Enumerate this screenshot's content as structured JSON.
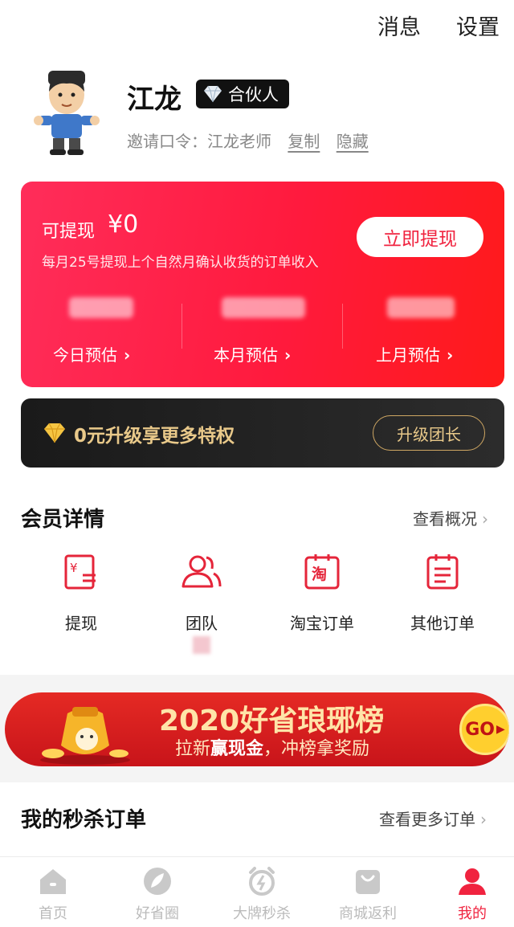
{
  "header": {
    "messages_label": "消息",
    "settings_label": "设置"
  },
  "profile": {
    "name": "江龙",
    "badge": "合伙人",
    "invite_label": "邀请口令：",
    "invite_code": "江龙老师",
    "copy_label": "复制",
    "hide_label": "隐藏"
  },
  "earnings": {
    "withdrawable_label": "可提现",
    "withdrawable_amount": "¥0",
    "note": "每月25号提现上个自然月确认收货的订单收入",
    "withdraw_button": "立即提现",
    "stats": [
      {
        "label": "今日预估"
      },
      {
        "label": "本月预估"
      },
      {
        "label": "上月预估"
      }
    ]
  },
  "upgrade": {
    "text": "0元升级享更多特权",
    "button": "升级团长"
  },
  "member": {
    "title": "会员详情",
    "more": "查看概况",
    "items": [
      {
        "label": "提现",
        "icon": "withdraw-icon"
      },
      {
        "label": "团队",
        "icon": "team-icon"
      },
      {
        "label": "淘宝订单",
        "icon": "taobao-order-icon"
      },
      {
        "label": "其他订单",
        "icon": "other-order-icon"
      }
    ]
  },
  "banner": {
    "title": "2020好省琅琊榜",
    "subtitle_prefix": "拉新",
    "subtitle_bold": "赢现金",
    "subtitle_suffix": "，冲榜拿奖励",
    "go": "GO"
  },
  "flash_orders": {
    "title": "我的秒杀订单",
    "more": "查看更多订单"
  },
  "tabs": [
    {
      "label": "首页",
      "icon": "home-icon"
    },
    {
      "label": "好省圈",
      "icon": "leaf-icon"
    },
    {
      "label": "大牌秒杀",
      "icon": "alarm-icon"
    },
    {
      "label": "商城返利",
      "icon": "shopping-bag-icon"
    },
    {
      "label": "我的",
      "icon": "user-icon",
      "active": true
    }
  ],
  "colors": {
    "accent": "#f0233f",
    "gold": "#e9c98a",
    "inactive_tab": "#bbbbbb"
  }
}
